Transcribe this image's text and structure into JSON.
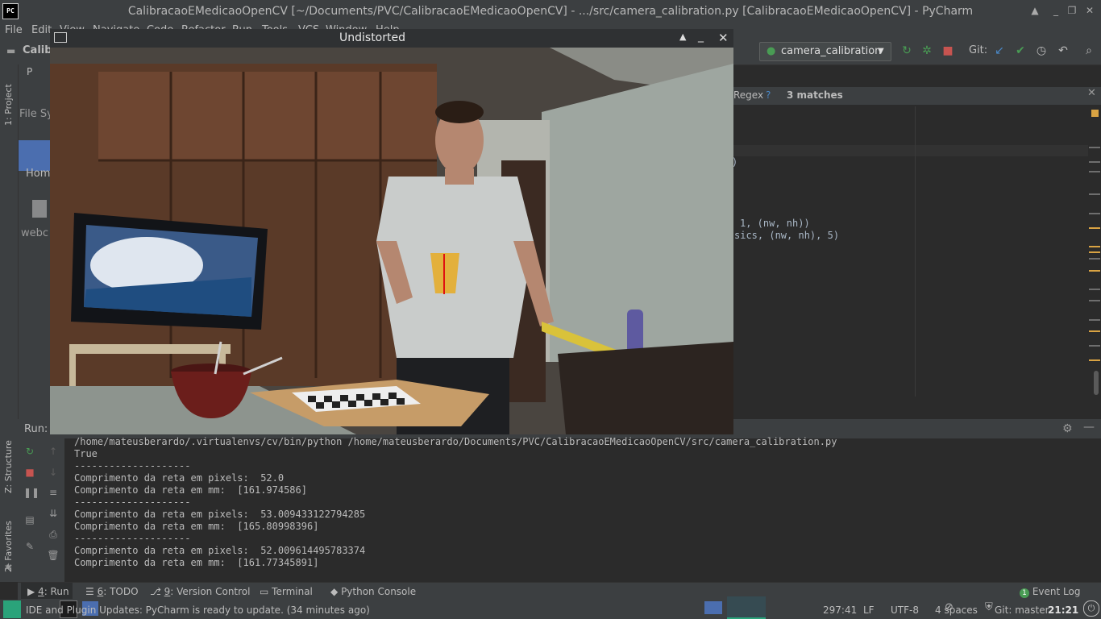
{
  "window": {
    "title": "CalibracaoEMedicaoOpenCV [~/Documents/PVC/CalibracaoEMedicaoOpenCV] - .../src/camera_calibration.py [CalibracaoEMedicaoOpenCV] - PyCharm",
    "logo": "PC"
  },
  "menu": [
    "File",
    "Edit",
    "View",
    "Navigate",
    "Code",
    "Refactor",
    "Run",
    "Tools",
    "VCS",
    "Window",
    "Help"
  ],
  "toolbar": {
    "project_crumb": "Calib",
    "run_config": "camera_calibration",
    "git_label": "Git:"
  },
  "project_panel": {
    "row1": "P",
    "row2": "File Sy",
    "home": "Hom",
    "file": "webc"
  },
  "find_bar": {
    "regex_label": "Regex",
    "help": "?",
    "matches": "3 matches"
  },
  "editor": {
    "lines": [
      ")",
      "1, (nw, nh))",
      "sics, (nw, nh), 5)"
    ]
  },
  "cv_window": {
    "title": "Undistorted"
  },
  "run_panel": {
    "label": "Run:",
    "console": [
      "/home/mateusberardo/.virtualenvs/cv/bin/python /home/mateusberardo/Documents/PVC/CalibracaoEMedicaoOpenCV/src/camera_calibration.py",
      "True",
      "--------------------",
      "Comprimento da reta em pixels:  52.0",
      "Comprimento da reta em mm:  [161.974586]",
      "--------------------",
      "Comprimento da reta em pixels:  53.009433122794285",
      "Comprimento da reta em mm:  [165.80998396]",
      "--------------------",
      "Comprimento da reta em pixels:  52.009614495783374",
      "Comprimento da reta em mm:  [161.77345891]"
    ]
  },
  "side_tabs": {
    "project": "1: Project",
    "structure": "Z: Structure",
    "favorites": "2: Favorites"
  },
  "tool_windows": [
    {
      "num": "4",
      "label": ": Run"
    },
    {
      "num": "6",
      "label": ": TODO"
    },
    {
      "num": "9",
      "label": ": Version Control"
    },
    {
      "num": "",
      "label": "Terminal"
    },
    {
      "num": "",
      "label": "Python Console"
    }
  ],
  "event_log": {
    "count": "1",
    "label": "Event Log"
  },
  "status": {
    "message": "IDE and Plugin Updates: PyCharm is ready to update. (34 minutes ago)",
    "position": "297:41",
    "line_sep": "LF",
    "encoding": "UTF-8",
    "indent": "4 spaces",
    "git": "Git: master",
    "clock": "21:21"
  },
  "colors": {
    "accent": "#4a88c7",
    "green": "#499c54",
    "red": "#c75450",
    "warning": "#d9a343"
  }
}
